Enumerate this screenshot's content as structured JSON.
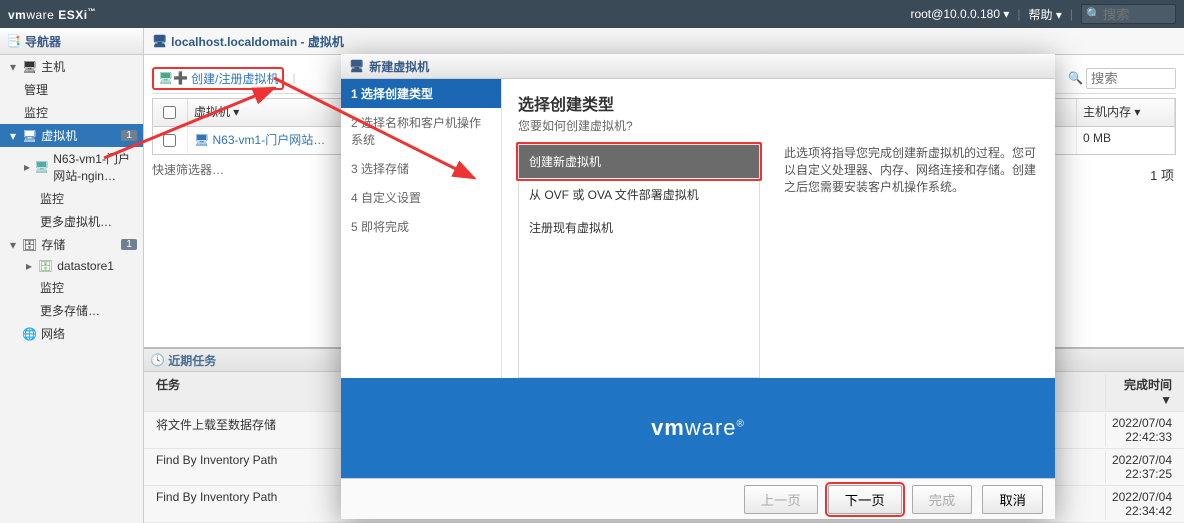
{
  "topbar": {
    "brand": "vmware ESXi",
    "user": "root@10.0.0.180 ▾",
    "help": "帮助 ▾",
    "search_placeholder": "搜索"
  },
  "navigator": {
    "title": "导航器",
    "items": {
      "host": {
        "label": "主机"
      },
      "manage": {
        "label": "管理"
      },
      "monitor": {
        "label": "监控"
      },
      "vm": {
        "label": "虚拟机",
        "badge": "1"
      },
      "vm1": {
        "label": "N63-vm1-门户网站-ngin…"
      },
      "vm1_mon": {
        "label": "监控"
      },
      "vm_more": {
        "label": "更多虚拟机…"
      },
      "storage": {
        "label": "存储",
        "badge": "1"
      },
      "ds1": {
        "label": "datastore1"
      },
      "ds1_mon": {
        "label": "监控"
      },
      "st_more": {
        "label": "更多存储…"
      },
      "network": {
        "label": "网络"
      }
    }
  },
  "crumb": "localhost.localdomain - 虚拟机",
  "toolbar": {
    "create": "创建/注册虚拟机",
    "search_placeholder": "搜索"
  },
  "table": {
    "cols": {
      "vm": "虚拟机",
      "mem": "主机内存"
    },
    "row1_vm": "N63-vm1-门户网站…",
    "row1_mem": "0 MB"
  },
  "filter_label": "快速筛选器…",
  "summary_count": "1 项",
  "tasks": {
    "title": "近期任务",
    "cols": {
      "task": "任务",
      "done": "完成时间 ▼"
    },
    "rows": [
      {
        "task": "将文件上载至数据存储",
        "date": "2022/07/04 22:42:33"
      },
      {
        "task": "Find By Inventory Path",
        "date": "2022/07/04 22:37:25"
      },
      {
        "task": "Find By Inventory Path",
        "date": "2022/07/04 22:34:42"
      }
    ]
  },
  "wizard": {
    "title": "新建虚拟机",
    "steps": {
      "s1": "1 选择创建类型",
      "s2": "2 选择名称和客户机操作系统",
      "s3": "3 选择存储",
      "s4": "4 自定义设置",
      "s5": "5 即将完成"
    },
    "heading": "选择创建类型",
    "subheading": "您要如何创建虚拟机?",
    "opts": {
      "o1": "创建新虚拟机",
      "o2": "从 OVF 或 OVA 文件部署虚拟机",
      "o3": "注册现有虚拟机"
    },
    "desc": "此选项将指导您完成创建新虚拟机的过程。您可以自定义处理器、内存、网络连接和存储。创建之后您需要安装客户机操作系统。",
    "brand": "vmware",
    "buttons": {
      "back": "上一页",
      "next": "下一页",
      "finish": "完成",
      "cancel": "取消"
    }
  }
}
